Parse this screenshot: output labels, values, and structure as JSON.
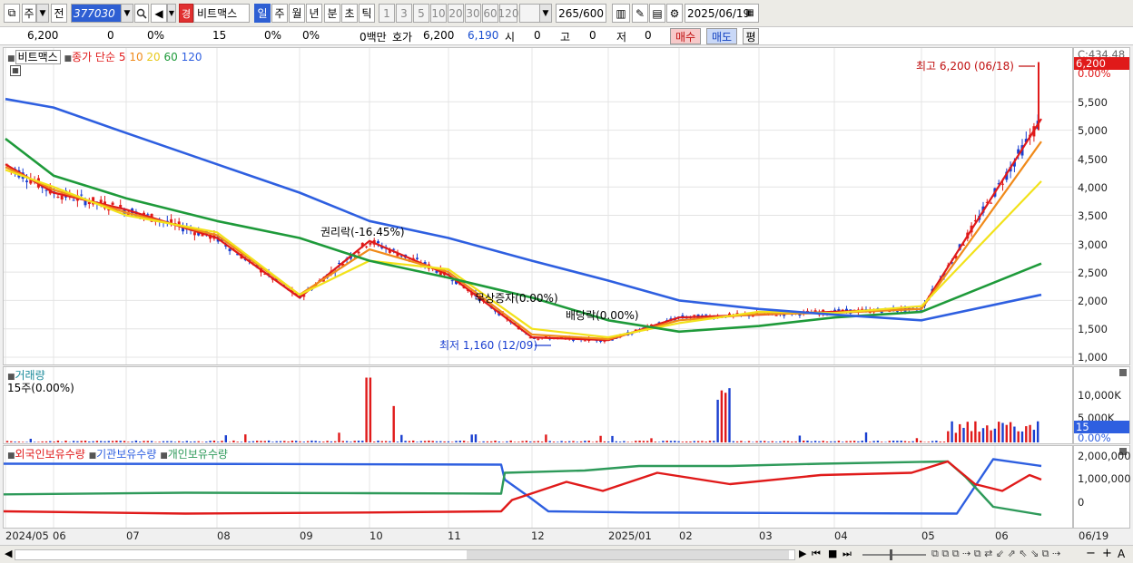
{
  "toolbar": {
    "type_label": "주",
    "prev_label": "전",
    "code": "377030",
    "name_badge": "경",
    "name": "비트맥스",
    "periods": [
      "일",
      "주",
      "월",
      "년",
      "분",
      "초",
      "틱"
    ],
    "intervals": [
      "1",
      "3",
      "5",
      "10",
      "20",
      "30",
      "60",
      "120"
    ],
    "count": "265",
    "count_total": "/600",
    "date": "2025/06/19"
  },
  "infobar": {
    "price": "6,200",
    "change": "0",
    "change_pct": "0%",
    "volume": "15",
    "vol_pct1": "0%",
    "vol_pct2": "0%",
    "amount": "0백만",
    "quote_label": "호가",
    "ask": "6,200",
    "bid": "6,190",
    "open_label": "시",
    "open": "0",
    "high_label": "고",
    "high": "0",
    "low_label": "저",
    "low": "0",
    "buy_label": "매수",
    "sell_label": "매도",
    "eval_label": "평"
  },
  "price_panel": {
    "name": "비트맥스",
    "ma_title": "종가 단순",
    "ma_periods": [
      "5",
      "10",
      "20",
      "60",
      "120"
    ],
    "y_top": "C:434.48",
    "last_price": "6,200",
    "pct_label": "0.00%",
    "y_ticks": [
      "5,500",
      "5,000",
      "4,500",
      "4,000",
      "3,500",
      "3,000",
      "2,500",
      "2,000",
      "1,500",
      "1,000"
    ],
    "annotation_high": "최고 6,200 (06/18)",
    "annotation_low": "최저 1,160 (12/09)",
    "annotation_rights": "권리락(-16.45%)",
    "annotation_bonus": "무상증자(0.00%)",
    "annotation_dividend": "배당락(0.00%)"
  },
  "volume_panel": {
    "title": "거래량",
    "value": "15주(0.00%)",
    "y_ticks": [
      "10,000K",
      "5,000K"
    ],
    "last": "15",
    "pct": "0.00%"
  },
  "holdings_panel": {
    "legend": [
      "외국인보유수량",
      "기관보유수량",
      "개인보유수량"
    ],
    "y_ticks": [
      "2,000,000",
      "1,000,000",
      "0"
    ]
  },
  "x_labels": [
    "2024/05",
    "06",
    "07",
    "08",
    "09",
    "10",
    "11",
    "12",
    "2025/01",
    "02",
    "03",
    "04",
    "05",
    "06"
  ],
  "x_last": "06/19",
  "colors": {
    "ma5": "#e01a1a",
    "ma10": "#f08a1a",
    "ma20": "#f2e21a",
    "ma60": "#1e9a3a",
    "ma120": "#2e5fe0",
    "foreign": "#e01a1a",
    "institution": "#2e5fe0",
    "individual": "#2e9a5a"
  },
  "chart_data": {
    "type": "line",
    "x": [
      "2024/05",
      "06",
      "07",
      "08",
      "09",
      "10",
      "11",
      "12",
      "2025/01",
      "02",
      "03",
      "04",
      "05",
      "06"
    ],
    "series": [
      {
        "name": "5",
        "values": [
          4400,
          3900,
          3600,
          3100,
          2050,
          3050,
          2450,
          1350,
          1300,
          1700,
          1750,
          1800,
          1850,
          5200
        ]
      },
      {
        "name": "10",
        "values": [
          4350,
          3950,
          3550,
          3150,
          2100,
          2900,
          2500,
          1400,
          1320,
          1650,
          1760,
          1780,
          1850,
          4800
        ]
      },
      {
        "name": "20",
        "values": [
          4300,
          4000,
          3500,
          3200,
          2100,
          2700,
          2550,
          1500,
          1350,
          1600,
          1800,
          1780,
          1900,
          4100
        ]
      },
      {
        "name": "60",
        "values": [
          4850,
          4200,
          3800,
          3400,
          3100,
          2700,
          2400,
          2050,
          1650,
          1450,
          1550,
          1700,
          1800,
          2650
        ]
      },
      {
        "name": "120",
        "values": [
          5550,
          5400,
          4950,
          4400,
          3900,
          3400,
          3100,
          2700,
          2350,
          2000,
          1850,
          1750,
          1650,
          2100
        ]
      }
    ],
    "ylim": [
      1000,
      6200
    ],
    "ylabel": "",
    "xlabel": ""
  }
}
